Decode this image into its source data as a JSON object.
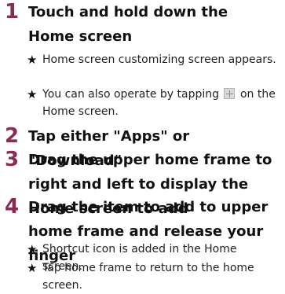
{
  "steps": [
    {
      "number": "1",
      "title": "Touch and hold down the Home screen",
      "notes": [
        {
          "bullet": "★",
          "text": "Home screen customizing screen appears."
        },
        {
          "bullet": "★",
          "text_before": "You can also operate by tapping",
          "icon": "menu-key-icon",
          "text_after": "on the Home screen."
        }
      ]
    },
    {
      "number": "2",
      "title": "Tap either \"Apps\" or \"Download\"",
      "notes": []
    },
    {
      "number": "3",
      "title": "Drag the upper home frame to right and left to display the Home screen to add",
      "notes": []
    },
    {
      "number": "4",
      "title": "Drag the item to add to upper home frame and release your finger",
      "notes": [
        {
          "bullet": "★",
          "text": "Shortcut icon is added in the Home screen."
        },
        {
          "bullet": "★",
          "text": "Tap home frame to return to the home screen."
        }
      ]
    }
  ],
  "colors": {
    "step_number": "#8a2a55",
    "text": "#111111"
  }
}
